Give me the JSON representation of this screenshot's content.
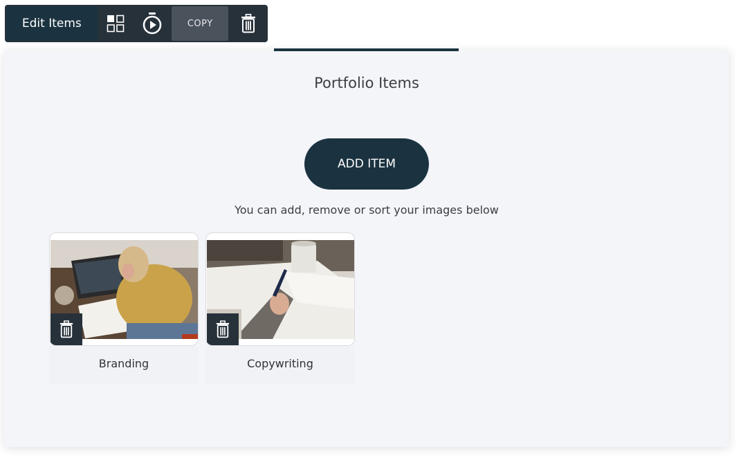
{
  "toolbar": {
    "title": "Edit Items",
    "icons": [
      "grid-layout-icon",
      "stopwatch-icon",
      "trash-icon"
    ],
    "copy_label": "COPY"
  },
  "panel": {
    "tab_title": "Portfolio Items",
    "add_button_label": "ADD ITEM",
    "hint": "You can add, remove or sort your images below"
  },
  "items": [
    {
      "label": "Branding",
      "image": "woman-at-laptop-photo"
    },
    {
      "label": "Copywriting",
      "image": "hand-writing-notes-photo"
    }
  ],
  "colors": {
    "accent": "#1b3340",
    "toolbar": "#27313a",
    "panel_bg": "#f4f5f9"
  }
}
